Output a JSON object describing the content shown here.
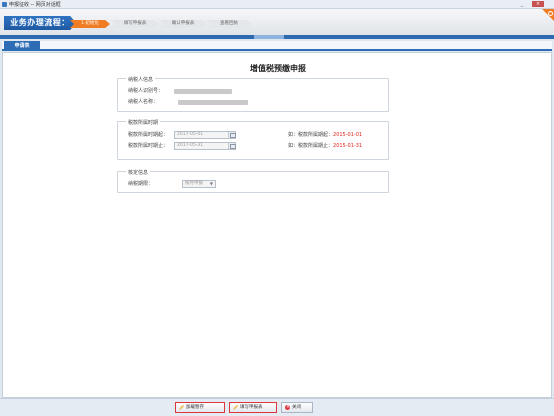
{
  "window": {
    "title": "申报征收 -- 网页对话框"
  },
  "steps": {
    "flow_title": "业务办理流程：",
    "items": [
      {
        "label": "1.初始化",
        "active": true
      },
      {
        "label": "填写申报表",
        "active": false
      },
      {
        "label": "确认申报表",
        "active": false
      },
      {
        "label": "查看回执",
        "active": false
      }
    ]
  },
  "tab": {
    "label": "申请表"
  },
  "page": {
    "title": "增值税预缴申报"
  },
  "taxpayer_section": {
    "legend": "纳税人信息",
    "id_label": "纳税人识别号：",
    "name_label": "纳税人名称："
  },
  "period_section": {
    "legend": "税款所属时期",
    "start_label": "税款所属时期起：",
    "start_value": "2017-05-01",
    "start_hint_prefix": "如：税款所属期起：",
    "start_hint_value": "2015-01-01",
    "end_label": "税款所属时期止：",
    "end_value": "2017-05-31",
    "end_hint_prefix": "如：税款所属期止：",
    "end_hint_value": "2015-01-31"
  },
  "verify_section": {
    "legend": "核定信息",
    "period_label": "纳税期限：",
    "period_value": "按月申报"
  },
  "footer": {
    "load_label": "加载暂存",
    "fill_label": "填写申报表",
    "close_label": "关闭"
  },
  "colors": {
    "accent": "#2e6cb5",
    "active_step": "#f07d24",
    "hint_red": "#e2231a"
  }
}
